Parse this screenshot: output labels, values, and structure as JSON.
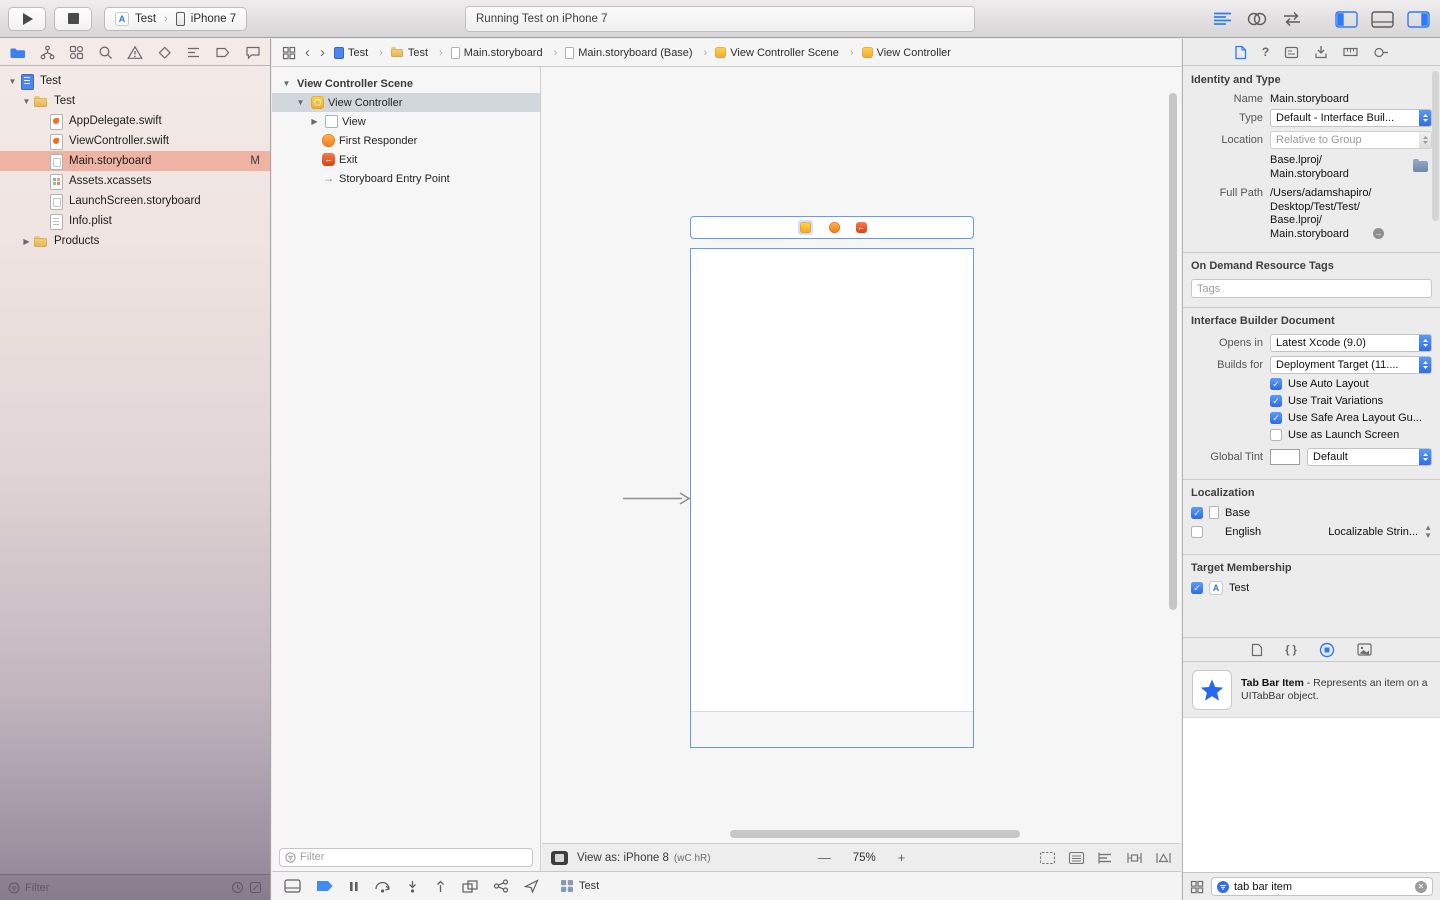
{
  "toolbar": {
    "scheme_name": "Test",
    "scheme_device": "iPhone 7",
    "status": "Running Test on iPhone 7"
  },
  "navigator": {
    "files": [
      {
        "label": "Test"
      },
      {
        "label": "Test"
      },
      {
        "label": "AppDelegate.swift"
      },
      {
        "label": "ViewController.swift"
      },
      {
        "label": "Main.storyboard",
        "badge": "M"
      },
      {
        "label": "Assets.xcassets"
      },
      {
        "label": "LaunchScreen.storyboard"
      },
      {
        "label": "Info.plist"
      },
      {
        "label": "Products"
      }
    ],
    "filter_placeholder": "Filter"
  },
  "jumpbar": {
    "crumbs": [
      {
        "label": "Test"
      },
      {
        "label": "Test"
      },
      {
        "label": "Main.storyboard"
      },
      {
        "label": "Main.storyboard (Base)"
      },
      {
        "label": "View Controller Scene"
      },
      {
        "label": "View Controller"
      }
    ]
  },
  "outline": {
    "scene": "View Controller Scene",
    "items": [
      {
        "label": "View Controller"
      },
      {
        "label": "View"
      },
      {
        "label": "First Responder"
      },
      {
        "label": "Exit"
      },
      {
        "label": "Storyboard Entry Point"
      }
    ],
    "filter_placeholder": "Filter"
  },
  "canvas": {
    "view_as": "View as: iPhone 8",
    "traits": "(wC hR)",
    "zoom": "75%",
    "zoom_out": "—",
    "zoom_in": "+"
  },
  "debugbar": {
    "process": "Test"
  },
  "inspector": {
    "identity_title": "Identity and Type",
    "name_label": "Name",
    "name_value": "Main.storyboard",
    "type_label": "Type",
    "type_value": "Default - Interface Buil...",
    "location_label": "Location",
    "location_value": "Relative to Group",
    "relative_path": [
      "Base.lproj/",
      "Main.storyboard"
    ],
    "full_path_label": "Full Path",
    "full_path": [
      "/Users/adamshapiro/",
      "Desktop/Test/Test/",
      "Base.lproj/",
      "Main.storyboard"
    ],
    "odr_title": "On Demand Resource Tags",
    "tags_placeholder": "Tags",
    "ibdoc_title": "Interface Builder Document",
    "opens_label": "Opens in",
    "opens_value": "Latest Xcode (9.0)",
    "builds_label": "Builds for",
    "builds_value": "Deployment Target (11....",
    "checkboxes": [
      {
        "label": "Use Auto Layout",
        "checked": true
      },
      {
        "label": "Use Trait Variations",
        "checked": true
      },
      {
        "label": "Use Safe Area Layout Gu...",
        "checked": true
      },
      {
        "label": "Use as Launch Screen",
        "checked": false
      }
    ],
    "tint_label": "Global Tint",
    "tint_value": "Default",
    "tint_color": "#1c40c6",
    "localization_title": "Localization",
    "loc_rows": [
      {
        "label": "Base",
        "value": ""
      },
      {
        "label": "English",
        "value": "Localizable Strin..."
      }
    ],
    "target_title": "Target Membership",
    "target_name": "Test",
    "library": {
      "item_title": "Tab Bar Item",
      "item_desc": " - Represents an item on a UITabBar object.",
      "search_value": "tab bar item"
    }
  }
}
